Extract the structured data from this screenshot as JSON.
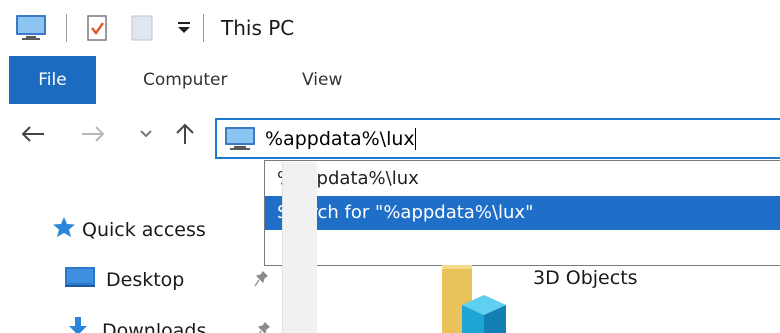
{
  "window": {
    "title": "This PC"
  },
  "ribbon": {
    "tabs": [
      {
        "label": "File",
        "active": true
      },
      {
        "label": "Computer"
      },
      {
        "label": "View"
      }
    ]
  },
  "address_bar": {
    "value": "%appdata%\\lux",
    "icon": "this-pc-icon"
  },
  "autocomplete": {
    "items": [
      {
        "label": "%appdata%\\lux",
        "highlighted": false
      },
      {
        "label": "Search for \"%appdata%\\lux\"",
        "highlighted": true
      }
    ]
  },
  "nav_pane": {
    "items": [
      {
        "label": "Quick access",
        "icon": "star-icon"
      },
      {
        "label": "Desktop",
        "icon": "desktop-icon",
        "pinned": true
      },
      {
        "label": "Downloads",
        "icon": "download-icon",
        "pinned": true
      }
    ]
  },
  "content": {
    "items": [
      {
        "label": "3D Objects",
        "icon": "3d-objects-icon"
      }
    ]
  },
  "colors": {
    "accent": "#1b6bc0",
    "highlight": "#1f6fc8",
    "address_border": "#1f78d1"
  }
}
